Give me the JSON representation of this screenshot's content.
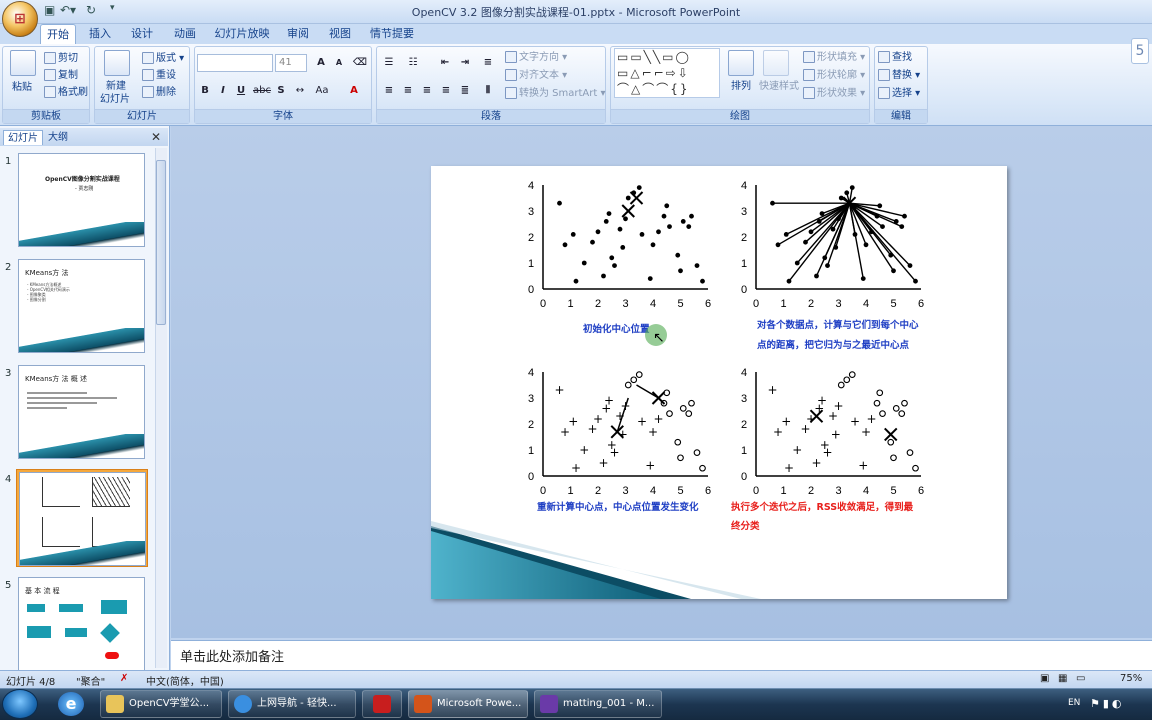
{
  "window": {
    "title": "OpenCV 3.2 图像分割实战课程-01.pptx - Microsoft PowerPoint"
  },
  "tabs": [
    "开始",
    "插入",
    "设计",
    "动画",
    "幻灯片放映",
    "审阅",
    "视图",
    "情节提要"
  ],
  "ribbon": {
    "clipboard": {
      "label": "剪贴板",
      "paste": "粘贴",
      "cut": "剪切",
      "copy": "复制",
      "format_painter": "格式刷"
    },
    "slides": {
      "label": "幻灯片",
      "new_slide_1": "新建",
      "new_slide_2": "幻灯片",
      "layout": "版式",
      "reset": "重设",
      "delete": "删除"
    },
    "font": {
      "label": "字体",
      "font_size": "41"
    },
    "paragraph": {
      "label": "段落",
      "text_direction": "文字方向",
      "align_text": "对齐文本",
      "smartart": "转换为 SmartArt"
    },
    "drawing": {
      "label": "绘图",
      "arrange": "排列",
      "quick_styles": "快速样式",
      "shape_fill": "形状填充",
      "shape_outline": "形状轮廓",
      "shape_effects": "形状效果"
    },
    "editing": {
      "label": "编辑",
      "find": "查找",
      "replace": "替换",
      "select": "选择"
    }
  },
  "left_panel": {
    "tab_slides": "幻灯片",
    "tab_outline": "大纲",
    "thumbs": [
      {
        "num": "1",
        "title": "OpenCV图像分割实战课程",
        "sub": "- 贾志刚"
      },
      {
        "num": "2",
        "title": "KMeans方 法",
        "lines": [
          "- KMeans方法概述",
          "- OpenCV相关代码演示",
          "- 图像聚类",
          "- 图像分割"
        ]
      },
      {
        "num": "3",
        "title": "KMeans方 法 概 述"
      },
      {
        "num": "4"
      },
      {
        "num": "5",
        "title": "基 本 流 程"
      }
    ]
  },
  "slide": {
    "labels": {
      "tl": "初始化中心位置",
      "tr_1": "对各个数据点，计算与它们到每个中心",
      "tr_2": "点的距离，把它归为与之最近中心点",
      "bl": "重新计算中心点，中心点位置发生变化",
      "br_1": "执行多个迭代之后，RSS收敛满足，得到最",
      "br_2": "终分类"
    },
    "axis_ticks_x": [
      "0",
      "1",
      "2",
      "3",
      "4",
      "5",
      "6"
    ],
    "axis_ticks_y": [
      "0",
      "1",
      "2",
      "3",
      "4"
    ],
    "colors": {
      "blue_text": "#1f3fc4",
      "red_text": "#e8201c"
    }
  },
  "notes": {
    "placeholder": "单击此处添加备注"
  },
  "status": {
    "slide": "幻灯片 4/8",
    "theme": "\"聚合\"",
    "language": "中文(简体，中国)",
    "zoom": "75%"
  },
  "taskbar": {
    "items": [
      "OpenCV学堂公...",
      "上网导航 - 轻快...",
      "",
      "Microsoft Powe...",
      "matting_001 - M..."
    ],
    "lang": "EN"
  }
}
